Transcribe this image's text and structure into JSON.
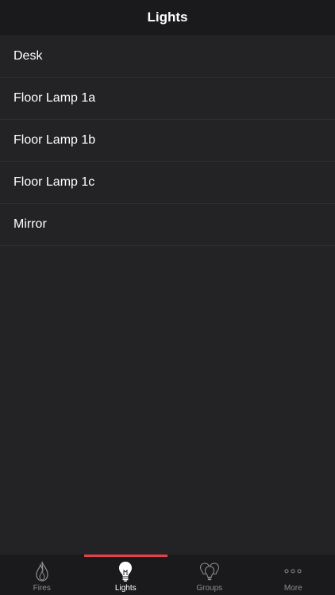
{
  "header": {
    "title": "Lights"
  },
  "lights": [
    {
      "name": "Desk"
    },
    {
      "name": "Floor Lamp 1a"
    },
    {
      "name": "Floor Lamp 1b"
    },
    {
      "name": "Floor Lamp 1c"
    },
    {
      "name": "Mirror"
    }
  ],
  "tabs": [
    {
      "label": "Fires",
      "icon": "flame-icon",
      "active": false
    },
    {
      "label": "Lights",
      "icon": "lightbulb-icon",
      "active": true
    },
    {
      "label": "Groups",
      "icon": "bulb-group-icon",
      "active": false
    },
    {
      "label": "More",
      "icon": "more-icon",
      "active": false
    }
  ],
  "colors": {
    "background": "#232326",
    "bar": "#1a1a1c",
    "accent": "#e2404a",
    "inactive_label": "#8e8e93"
  }
}
